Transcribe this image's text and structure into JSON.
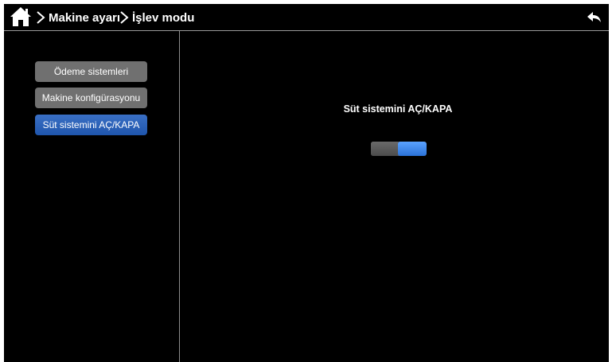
{
  "header": {
    "breadcrumb": [
      {
        "label": "Makine ayarı"
      },
      {
        "label": "İşlev modu"
      }
    ]
  },
  "sidebar": {
    "items": [
      {
        "label": "Ödeme sistemleri",
        "active": false
      },
      {
        "label": "Makine konfigürasyonu",
        "active": false
      },
      {
        "label": "Süt sistemini AÇ/KAPA",
        "active": true
      }
    ]
  },
  "main": {
    "setting_label": "Süt sistemini AÇ/KAPA",
    "toggle_state": "on"
  },
  "colors": {
    "background": "#000000",
    "active_accent": "#2b6cc8",
    "inactive_button": "#707070",
    "toggle_on": "#3f8df0"
  },
  "icons": {
    "home": "home-icon",
    "separator": "chevron-right-icon",
    "back": "back-arrow-icon"
  }
}
